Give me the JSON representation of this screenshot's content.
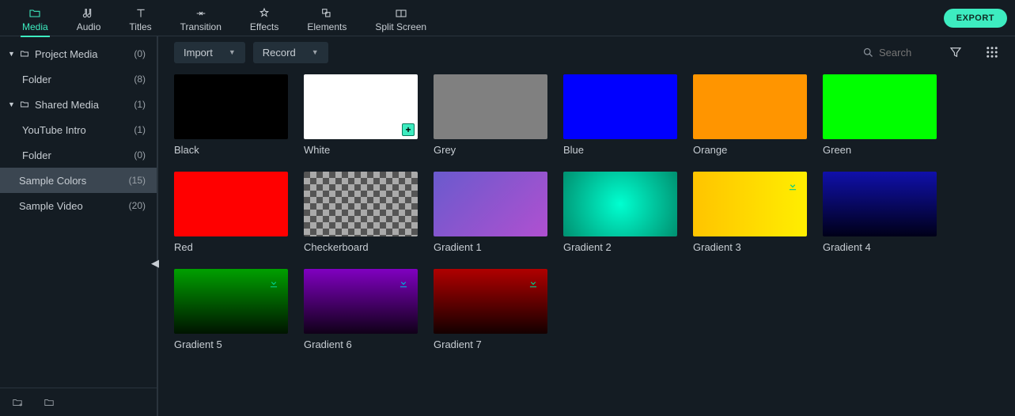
{
  "tabs": [
    {
      "id": "media",
      "label": "Media"
    },
    {
      "id": "audio",
      "label": "Audio"
    },
    {
      "id": "titles",
      "label": "Titles"
    },
    {
      "id": "transition",
      "label": "Transition"
    },
    {
      "id": "effects",
      "label": "Effects"
    },
    {
      "id": "elements",
      "label": "Elements"
    },
    {
      "id": "splitscreen",
      "label": "Split Screen"
    }
  ],
  "active_tab": "media",
  "export_label": "EXPORT",
  "sidebar": {
    "items": [
      {
        "label": "Project Media",
        "count": "(0)",
        "depth": 0,
        "disclosure": true,
        "folder": true
      },
      {
        "label": "Folder",
        "count": "(8)",
        "depth": 1,
        "disclosure": false,
        "folder": false
      },
      {
        "label": "Shared Media",
        "count": "(1)",
        "depth": 0,
        "disclosure": true,
        "folder": true
      },
      {
        "label": "YouTube Intro",
        "count": "(1)",
        "depth": 1,
        "disclosure": false,
        "folder": false
      },
      {
        "label": "Folder",
        "count": "(0)",
        "depth": 1,
        "disclosure": false,
        "folder": false
      },
      {
        "label": "Sample Colors",
        "count": "(15)",
        "depth": 0,
        "disclosure": false,
        "folder": false,
        "selected": true
      },
      {
        "label": "Sample Video",
        "count": "(20)",
        "depth": 0,
        "disclosure": false,
        "folder": false
      }
    ]
  },
  "dropdowns": {
    "import": "Import",
    "record": "Record"
  },
  "search_placeholder": "Search",
  "cards": [
    {
      "label": "Black",
      "bg": "#000000"
    },
    {
      "label": "White",
      "bg": "#ffffff",
      "plus": true
    },
    {
      "label": "Grey",
      "bg": "#808080"
    },
    {
      "label": "Blue",
      "bg": "#0000ff"
    },
    {
      "label": "Orange",
      "bg": "#ff9500"
    },
    {
      "label": "Green",
      "bg": "#00ff00"
    },
    {
      "label": "Red",
      "bg": "#ff0000"
    },
    {
      "label": "Checkerboard",
      "checker": true
    },
    {
      "label": "Gradient 1",
      "grad": "linear-gradient(135deg,#6a5acd,#b050d0)"
    },
    {
      "label": "Gradient 2",
      "grad": "radial-gradient(circle,#00ffd0,#009070)"
    },
    {
      "label": "Gradient 3",
      "grad": "linear-gradient(90deg,#ffc400,#ffee00)",
      "dl": true,
      "dlColor": "#00cc88"
    },
    {
      "label": "Gradient 4",
      "grad": "linear-gradient(180deg,#1010aa,#000018)"
    },
    {
      "label": "Gradient 5",
      "grad": "linear-gradient(180deg,#00a000,#001400)",
      "dl": true,
      "dlColor": "#00cc88"
    },
    {
      "label": "Gradient 6",
      "grad": "linear-gradient(180deg,#8000c0,#100018)",
      "dl": true,
      "dlColor": "#00aadd"
    },
    {
      "label": "Gradient 7",
      "grad": "linear-gradient(180deg,#b00000,#140000)",
      "dl": true,
      "dlColor": "#00cc88"
    }
  ]
}
